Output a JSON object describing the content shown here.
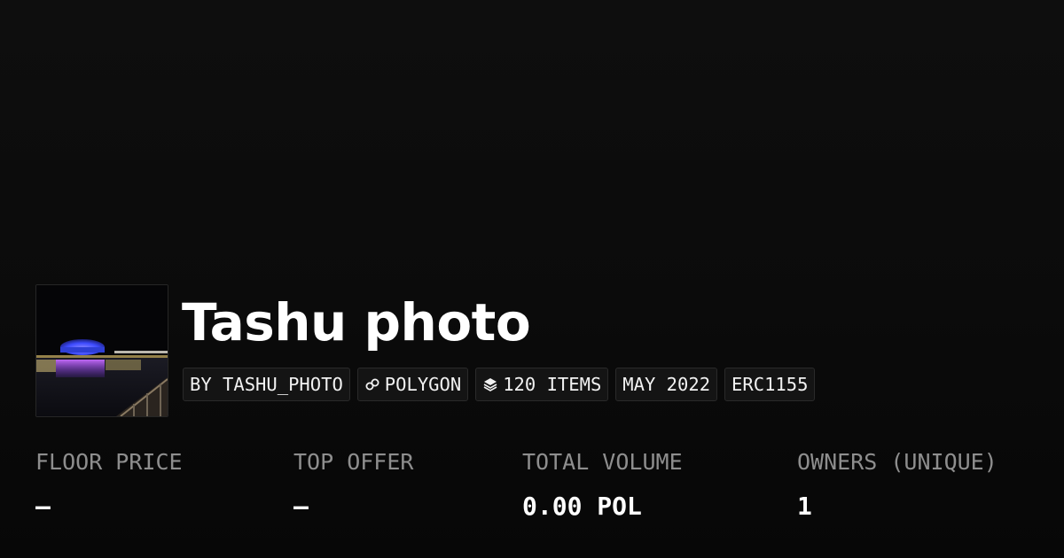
{
  "collection": {
    "title": "Tashu photo",
    "thumbnail_icon": "collection-photo-night-stadium"
  },
  "tags": [
    {
      "icon": "",
      "label": "BY TASHU_PHOTO"
    },
    {
      "icon": "polygon-chain-icon",
      "label": "POLYGON"
    },
    {
      "icon": "layers-icon",
      "label": "120 ITEMS"
    },
    {
      "icon": "",
      "label": "MAY 2022"
    },
    {
      "icon": "",
      "label": "ERC1155"
    }
  ],
  "stats": [
    {
      "label": "FLOOR PRICE",
      "value": "–"
    },
    {
      "label": "TOP OFFER",
      "value": "–"
    },
    {
      "label": "TOTAL VOLUME",
      "value": "0.00 POL"
    },
    {
      "label": "OWNERS (UNIQUE)",
      "value": "1"
    }
  ],
  "colors": {
    "background": "#0b0b0b",
    "text": "#ffffff",
    "muted": "#8e8e8e",
    "tag_bg": "#141414",
    "tag_border": "#2a2a2a"
  }
}
